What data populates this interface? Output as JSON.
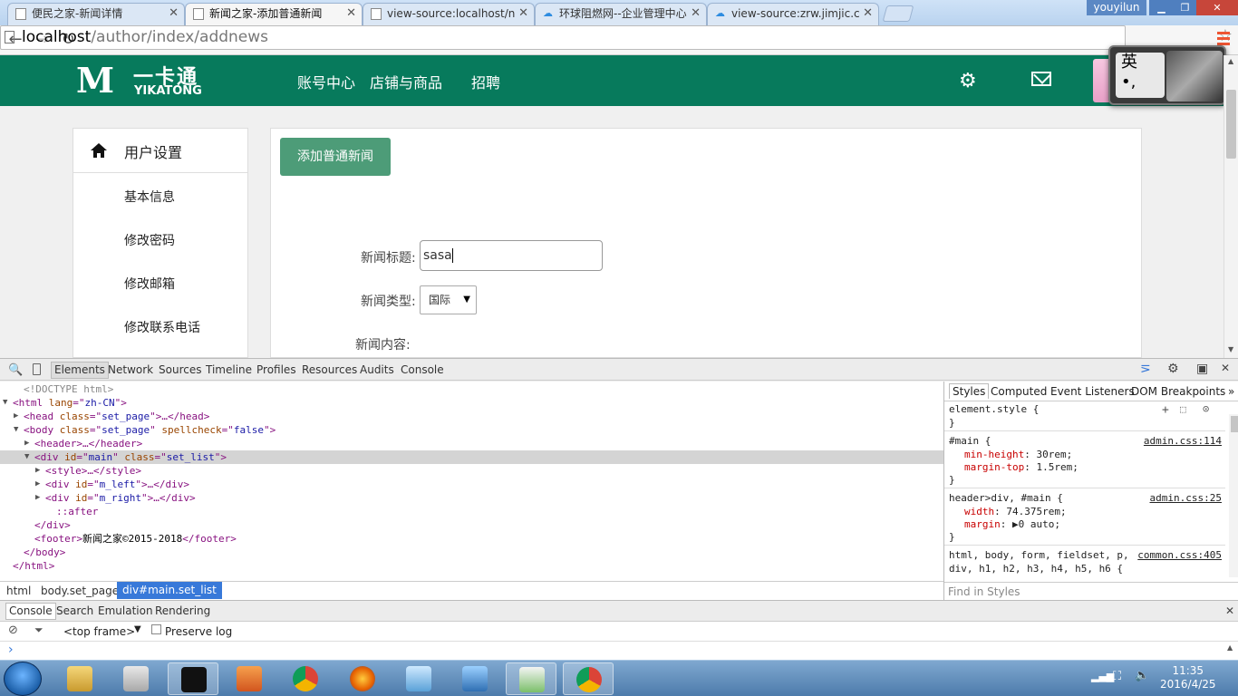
{
  "browser": {
    "tabs": [
      {
        "title": "便民之家-新闻详情",
        "favicon": "page-icon"
      },
      {
        "title": "新闻之家-添加普通新闻",
        "favicon": "page-icon",
        "active": true
      },
      {
        "title": "view-source:localhost/n",
        "favicon": "page-icon"
      },
      {
        "title": "环球阻燃网--企业管理中心",
        "favicon": "cloud-icon"
      },
      {
        "title": "view-source:zrw.jimjic.c",
        "favicon": "cloud-icon"
      }
    ],
    "user_badge": "youyilun",
    "url_host": "localhost",
    "url_path": "/author/index/addnews"
  },
  "site": {
    "logo_mark": "M",
    "logo_cn": "一卡通",
    "logo_en": "YIKATONG",
    "nav": [
      "账号中心",
      "店铺与商品",
      "招聘"
    ],
    "ime_char": "英",
    "ime_sub": "•,"
  },
  "sidebar": {
    "title": "用户设置",
    "items": [
      "基本信息",
      "修改密码",
      "修改邮箱",
      "修改联系电话"
    ]
  },
  "form": {
    "add_button": "添加普通新闻",
    "title_label": "新闻标题:",
    "title_value": "sasa",
    "type_label": "新闻类型:",
    "type_value": "国际",
    "content_label": "新闻内容:"
  },
  "devtools": {
    "tabs": [
      "Elements",
      "Network",
      "Sources",
      "Timeline",
      "Profiles",
      "Resources",
      "Audits",
      "Console"
    ],
    "active_tab": "Elements",
    "dom_lines": [
      {
        "indent": 1,
        "arrow": "",
        "parts": [
          [
            "cm",
            "<!DOCTYPE html>"
          ]
        ]
      },
      {
        "indent": 0,
        "arrow": "▼",
        "parts": [
          [
            "tg",
            "<html "
          ],
          [
            "an",
            "lang"
          ],
          [
            "tg",
            "=\""
          ],
          [
            "av",
            "zh-CN"
          ],
          [
            "tg",
            "\">"
          ]
        ]
      },
      {
        "indent": 1,
        "arrow": "▶",
        "parts": [
          [
            "tg",
            "<head "
          ],
          [
            "an",
            "class"
          ],
          [
            "tg",
            "=\""
          ],
          [
            "av",
            "set_page"
          ],
          [
            "tg",
            "\">…</head>"
          ]
        ]
      },
      {
        "indent": 1,
        "arrow": "▼",
        "parts": [
          [
            "tg",
            "<body "
          ],
          [
            "an",
            "class"
          ],
          [
            "tg",
            "=\""
          ],
          [
            "av",
            "set_page"
          ],
          [
            "tg",
            "\" "
          ],
          [
            "an",
            "spellcheck"
          ],
          [
            "tg",
            "=\""
          ],
          [
            "av",
            "false"
          ],
          [
            "tg",
            "\">"
          ]
        ]
      },
      {
        "indent": 2,
        "arrow": "▶",
        "parts": [
          [
            "tg",
            "<header>…</header>"
          ]
        ]
      },
      {
        "indent": 2,
        "arrow": "▼",
        "parts": [
          [
            "tg",
            "<div "
          ],
          [
            "an",
            "id"
          ],
          [
            "tg",
            "=\""
          ],
          [
            "av",
            "main"
          ],
          [
            "tg",
            "\" "
          ],
          [
            "an",
            "class"
          ],
          [
            "tg",
            "=\""
          ],
          [
            "av",
            "set_list"
          ],
          [
            "tg",
            "\">"
          ]
        ],
        "selected": true
      },
      {
        "indent": 3,
        "arrow": "▶",
        "parts": [
          [
            "tg",
            "<style>…</style>"
          ]
        ]
      },
      {
        "indent": 3,
        "arrow": "▶",
        "parts": [
          [
            "tg",
            "<div "
          ],
          [
            "an",
            "id"
          ],
          [
            "tg",
            "=\""
          ],
          [
            "av",
            "m_left"
          ],
          [
            "tg",
            "\">…</div>"
          ]
        ]
      },
      {
        "indent": 3,
        "arrow": "▶",
        "parts": [
          [
            "tg",
            "<div "
          ],
          [
            "an",
            "id"
          ],
          [
            "tg",
            "=\""
          ],
          [
            "av",
            "m_right"
          ],
          [
            "tg",
            "\">…</div>"
          ]
        ]
      },
      {
        "indent": 4,
        "arrow": "",
        "parts": [
          [
            "tg",
            "::after"
          ]
        ]
      },
      {
        "indent": 2,
        "arrow": "",
        "parts": [
          [
            "tg",
            "</div>"
          ]
        ]
      },
      {
        "indent": 2,
        "arrow": "",
        "parts": [
          [
            "tg",
            "<footer>"
          ],
          [
            "tx",
            "新闻之家©2015-2018"
          ],
          [
            "tg",
            "</footer>"
          ]
        ]
      },
      {
        "indent": 1,
        "arrow": "",
        "parts": [
          [
            "tg",
            "</body>"
          ]
        ]
      },
      {
        "indent": 0,
        "arrow": "",
        "parts": [
          [
            "tg",
            "</html>"
          ]
        ]
      }
    ],
    "styles_tabs": [
      "Styles",
      "Computed",
      "Event Listeners",
      "DOM Breakpoints"
    ],
    "style_rules": [
      {
        "selector": "element.style {",
        "source": "",
        "props": [],
        "close": "}"
      },
      {
        "selector": "#main {",
        "source": "admin.css:114",
        "props": [
          [
            "min-height",
            "30rem;"
          ],
          [
            "margin-top",
            "1.5rem;"
          ]
        ],
        "close": "}"
      },
      {
        "selector": "header>div, #main {",
        "source": "admin.css:25",
        "props": [
          [
            "width",
            "74.375rem;"
          ],
          [
            "margin",
            "▶0 auto;"
          ]
        ],
        "close": "}"
      },
      {
        "selector": "html, body, form, fieldset, p,",
        "source": "common.css:405",
        "props": [],
        "close": "div, h1, h2, h3, h4, h5, h6 {"
      }
    ],
    "find_styles": "Find in Styles",
    "breadcrumbs": [
      "html",
      "body.set_page",
      "div#main.set_list"
    ],
    "drawer_tabs": [
      "Console",
      "Search",
      "Emulation",
      "Rendering"
    ],
    "console_frame": "<top frame>",
    "preserve_log": "Preserve log",
    "prompt": "›"
  },
  "taskbar": {
    "apps": [
      "explorer-icon",
      "scissors-icon",
      "cmd-icon",
      "pdf-icon",
      "chrome-icon",
      "firefox-icon",
      "notepad-icon",
      "network-icon",
      "editor-icon",
      "chrome-icon"
    ],
    "time": "11:35",
    "date": "2016/4/25"
  },
  "colors": {
    "header_green": "#077a5c",
    "button_green": "#4d9c78",
    "selection_blue": "#3879d9"
  }
}
